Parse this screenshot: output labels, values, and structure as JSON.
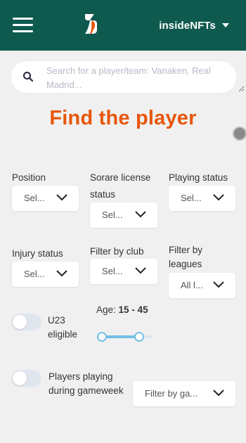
{
  "header": {
    "user_name": "insideNFTs",
    "bg_color": "#0f5a4f"
  },
  "search": {
    "placeholder": "Search for a player/team: Vanaken, Real Madrid..."
  },
  "title": "Find the player",
  "filters": {
    "position": {
      "label": "Position",
      "value": "Sel..."
    },
    "license": {
      "label": "Sorare license status",
      "value": "Sel..."
    },
    "playing": {
      "label": "Playing status",
      "value": "Sel..."
    },
    "injury": {
      "label": "Injury status",
      "value": "Sel..."
    },
    "club": {
      "label": "Filter by club",
      "value": "Sel..."
    },
    "leagues": {
      "label": "Filter by leagues",
      "value": "All l..."
    },
    "game": {
      "value": "Filter by ga..."
    }
  },
  "u23": {
    "label": "U23 eligible",
    "enabled": false
  },
  "age": {
    "label": "Age:",
    "range_text": "15 - 45",
    "min": 15,
    "max": 45
  },
  "gameweek": {
    "label": "Players playing during gameweek",
    "enabled": false
  },
  "colors": {
    "accent": "#e8560c",
    "slider": "#74bfe6"
  },
  "icons": [
    "menu-icon",
    "sorare-logo",
    "caret-down-icon",
    "search-icon",
    "chevron-down-icon"
  ]
}
